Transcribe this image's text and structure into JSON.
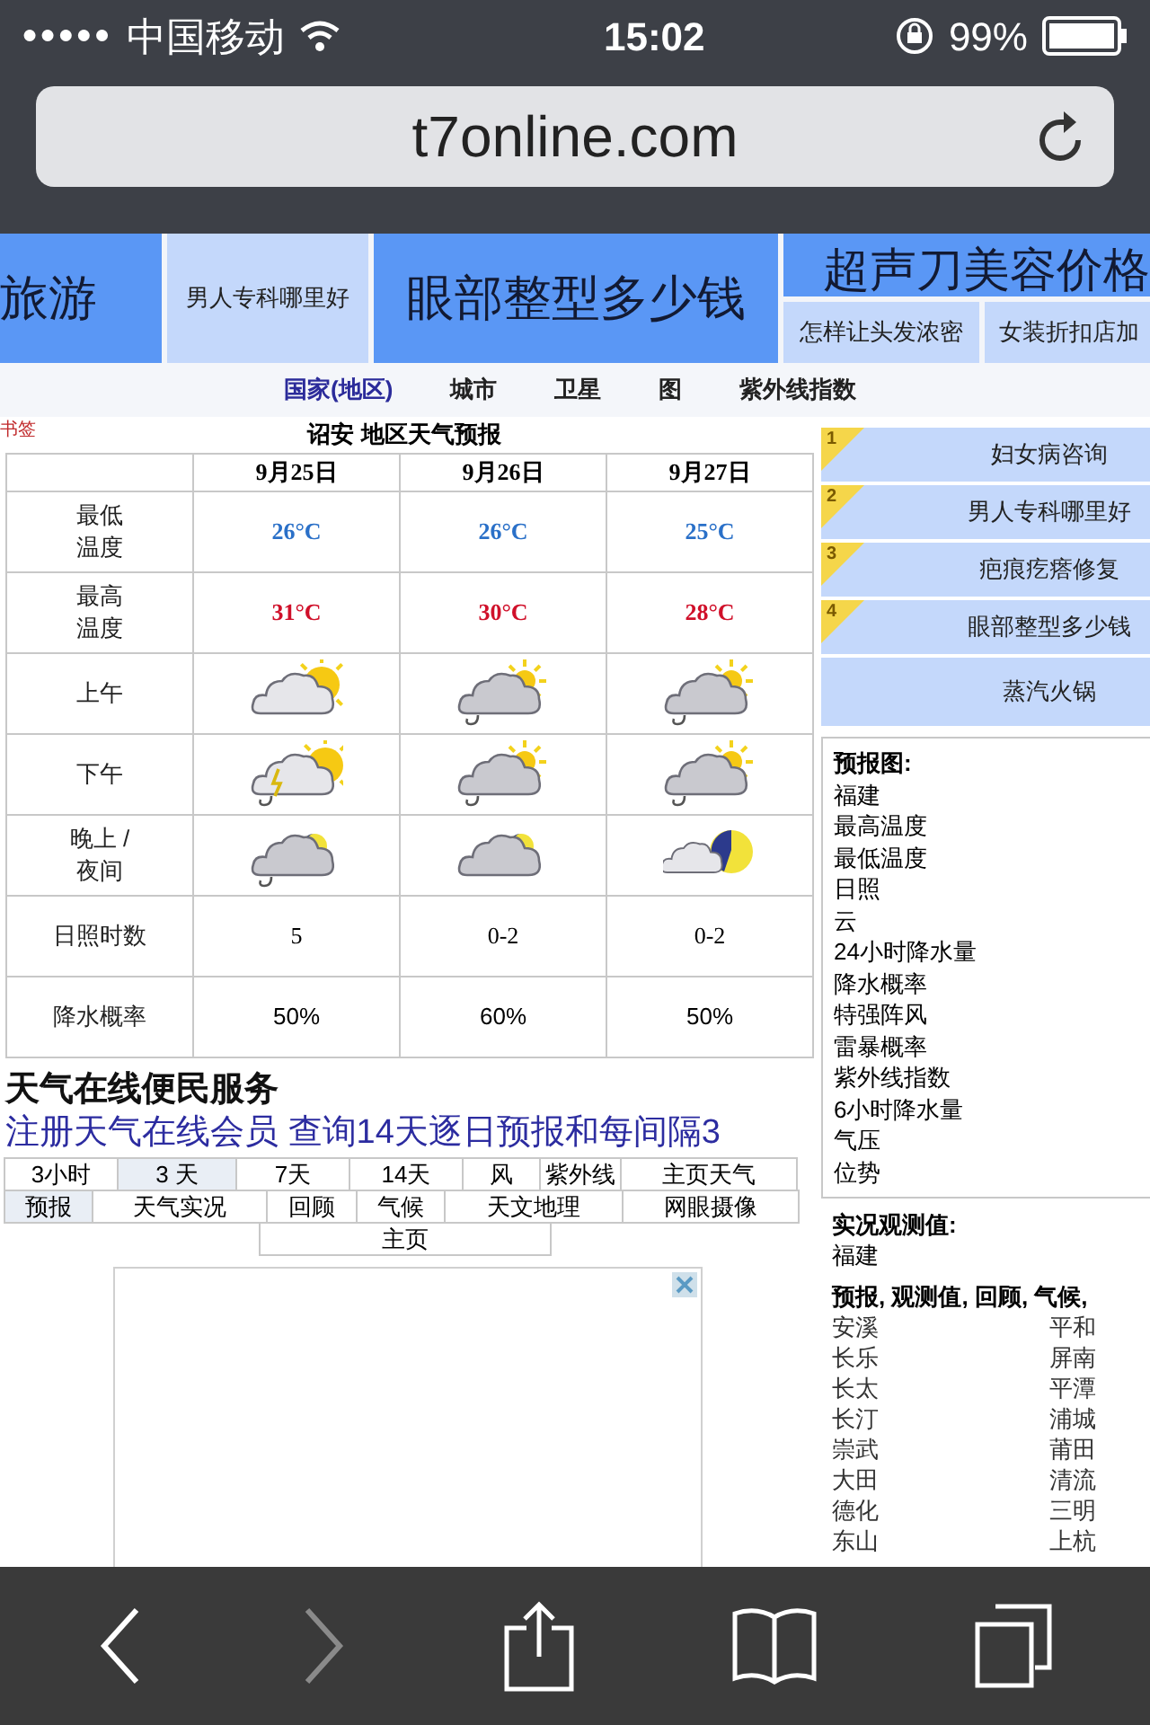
{
  "status_bar": {
    "signal": "●●●●●",
    "carrier": "中国移动",
    "time": "15:02",
    "battery": "99%"
  },
  "browser": {
    "url": "t7online.com"
  },
  "top_ads": [
    {
      "text": "旅游",
      "kind": "strong"
    },
    {
      "text": "男人专科哪里好",
      "kind": "light"
    },
    {
      "text": "眼部整型多少钱",
      "kind": "strong"
    },
    {
      "text": "超声刀美容价格",
      "kind": "strong"
    },
    {
      "text": "怎样让头发浓密",
      "kind": "light"
    },
    {
      "text": "女装折扣店加",
      "kind": "light"
    }
  ],
  "nav": [
    {
      "text": "国家(地区)",
      "kind": "link"
    },
    {
      "text": "城市",
      "kind": "label"
    },
    {
      "text": "卫星",
      "kind": "label"
    },
    {
      "text": "图",
      "kind": "label"
    },
    {
      "text": "紫外线指数",
      "kind": "label"
    }
  ],
  "bookmark": "书签",
  "forecast": {
    "title": "诏安 地区天气预报",
    "days": [
      "9月25日",
      "9月26日",
      "9月27日"
    ],
    "rows": [
      {
        "label": [
          "最低",
          "温度"
        ],
        "kind": "low",
        "values": [
          "26°C",
          "26°C",
          "25°C"
        ]
      },
      {
        "label": [
          "最高",
          "温度"
        ],
        "kind": "high",
        "values": [
          "31°C",
          "30°C",
          "28°C"
        ]
      },
      {
        "label": [
          "上午"
        ],
        "kind": "icon"
      },
      {
        "label": [
          "下午"
        ],
        "kind": "icon"
      },
      {
        "label": [
          "晚上 /",
          "夜间"
        ],
        "kind": "icon"
      },
      {
        "label": [
          "日照时数"
        ],
        "kind": "text",
        "values": [
          "5",
          "0-2",
          "0-2"
        ]
      },
      {
        "label": [
          "降水概率"
        ],
        "kind": "text",
        "values": [
          "50%",
          "60%",
          "50%"
        ]
      }
    ]
  },
  "services": {
    "title": "天气在线便民服务",
    "promo": "注册天气在线会员 查询14天逐日预报和每间隔3",
    "menus": [
      [
        {
          "label": "3小时",
          "selected": false
        },
        {
          "label": "3 天",
          "selected": true
        },
        {
          "label": "7天",
          "selected": false
        },
        {
          "label": "14天",
          "selected": false
        },
        {
          "label": "风",
          "selected": false
        },
        {
          "label": "紫外线",
          "selected": false
        },
        {
          "label": "主页天气",
          "selected": false
        }
      ],
      [
        {
          "label": "预报",
          "selected": true
        },
        {
          "label": "天气实况",
          "selected": false
        },
        {
          "label": "回顾",
          "selected": false
        },
        {
          "label": "气候",
          "selected": false
        },
        {
          "label": "天文地理",
          "selected": false
        },
        {
          "label": "网眼摄像",
          "selected": false
        }
      ],
      [
        {
          "label": "主页",
          "selected": false
        }
      ]
    ]
  },
  "side_ads": [
    {
      "rank": "1",
      "text": "妇女病咨询"
    },
    {
      "rank": "2",
      "text": "男人专科哪里好"
    },
    {
      "rank": "3",
      "text": "疤痕疙瘩修复"
    },
    {
      "rank": "4",
      "text": "眼部整型多少钱"
    },
    {
      "text": "蒸汽火锅"
    }
  ],
  "maps": {
    "title": "预报图:",
    "items": [
      "福建",
      "最高温度",
      "最低温度",
      "日照",
      "云",
      "24小时降水量",
      "降水概率",
      "特强阵风",
      "雷暴概率",
      "紫外线指数",
      "6小时降水量",
      "气压",
      "位势"
    ]
  },
  "observed": {
    "title": "实况观测值:",
    "items": [
      "福建"
    ]
  },
  "stations": {
    "title": "预报, 观测值, 回顾, 气候,",
    "cities": [
      [
        "安溪",
        "平和"
      ],
      [
        "长乐",
        "屏南"
      ],
      [
        "长太",
        "平潭"
      ],
      [
        "长汀",
        "浦城"
      ],
      [
        "崇武",
        "莆田"
      ],
      [
        "大田",
        "清流"
      ],
      [
        "德化",
        "三明"
      ],
      [
        "东山",
        "上杭"
      ]
    ]
  },
  "toolbar": [
    {
      "kind": "back",
      "disabled": false
    },
    {
      "kind": "forward",
      "disabled": true
    },
    {
      "kind": "share",
      "disabled": false
    },
    {
      "kind": "bookmarks",
      "disabled": false
    },
    {
      "kind": "tabs",
      "disabled": false
    }
  ]
}
